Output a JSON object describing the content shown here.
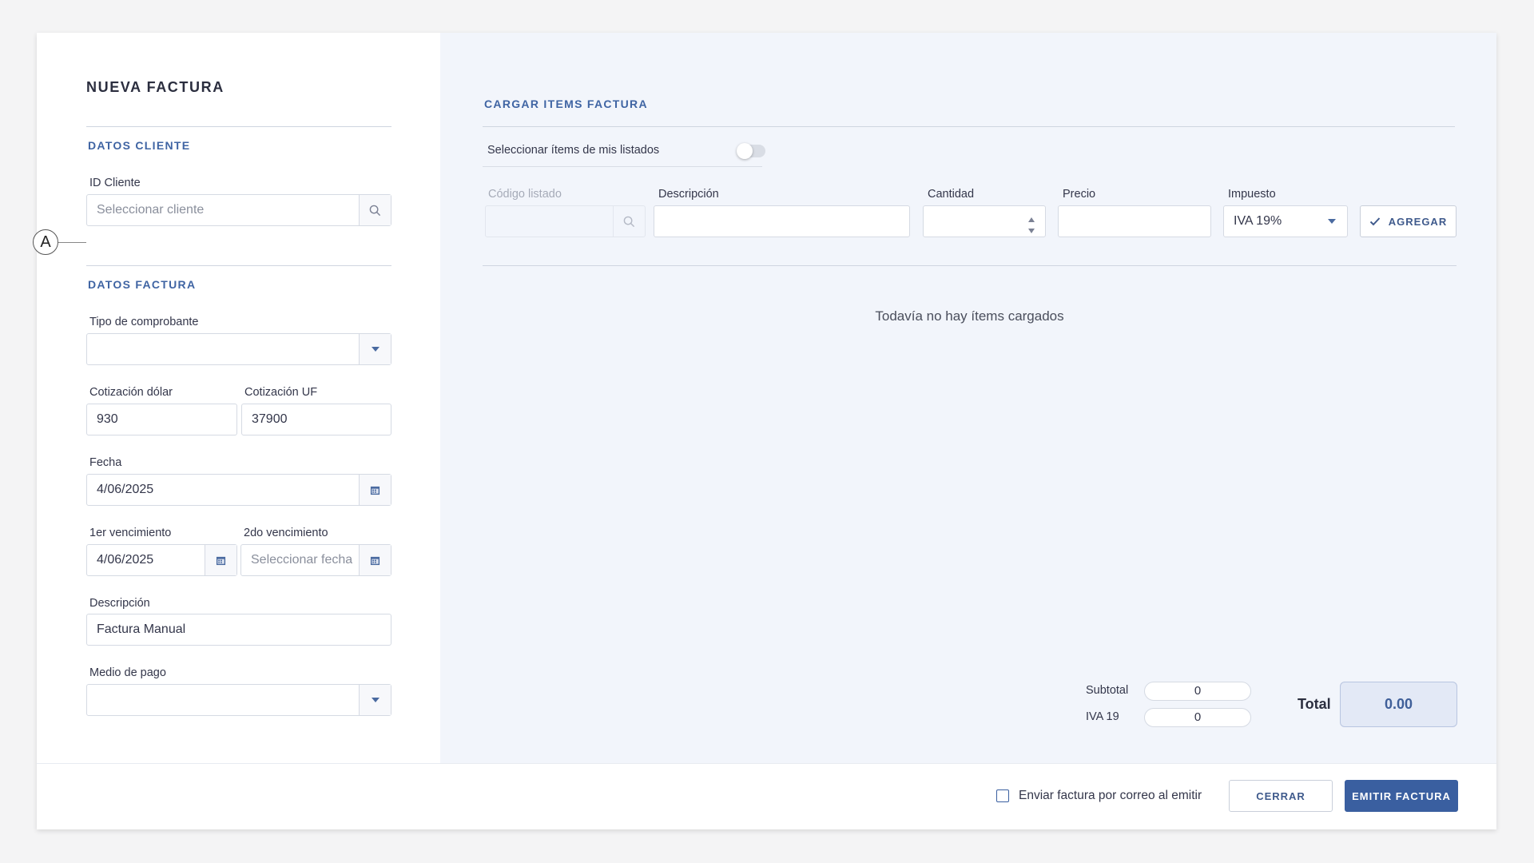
{
  "left": {
    "title": "NUEVA FACTURA",
    "client_section": "DATOS CLIENTE",
    "client_id_label": "ID Cliente",
    "client_id_placeholder": "Seleccionar cliente",
    "marker_label": "A",
    "invoice_section": "DATOS FACTURA",
    "voucher_type_label": "Tipo de comprobante",
    "voucher_type_value": "",
    "dollar_rate_label": "Cotización dólar",
    "dollar_rate_value": "930",
    "uf_rate_label": "Cotización UF",
    "uf_rate_value": "37900",
    "date_label": "Fecha",
    "date_value": "4/06/2025",
    "due1_label": "1er vencimiento",
    "due1_value": "4/06/2025",
    "due2_label": "2do vencimiento",
    "due2_placeholder": "Seleccionar fecha",
    "description_label": "Descripción",
    "description_value": "Factura Manual",
    "payment_label": "Medio de pago",
    "payment_value": ""
  },
  "right": {
    "section_title": "CARGAR ITEMS FACTURA",
    "select_from_lists_label": "Seleccionar ítems de mis listados",
    "select_from_lists_on": false,
    "col_code": "Código listado",
    "col_description": "Descripción",
    "col_quantity": "Cantidad",
    "col_price": "Precio",
    "col_tax": "Impuesto",
    "tax_value": "IVA 19%",
    "add_button": "AGREGAR",
    "empty_message": "Todavía no hay ítems cargados",
    "subtotal_label": "Subtotal",
    "subtotal_value": "0",
    "iva_label": "IVA 19",
    "iva_value": "0",
    "total_label": "Total",
    "total_value": "0.00"
  },
  "footer": {
    "email_checkbox_label": "Enviar factura por correo al emitir",
    "email_checked": false,
    "close_button": "CERRAR",
    "issue_button": "EMITIR FACTURA"
  },
  "colors": {
    "accent": "#3a5fa0",
    "section_title": "#3f64a3",
    "right_pane_bg": "#f2f5fb"
  }
}
